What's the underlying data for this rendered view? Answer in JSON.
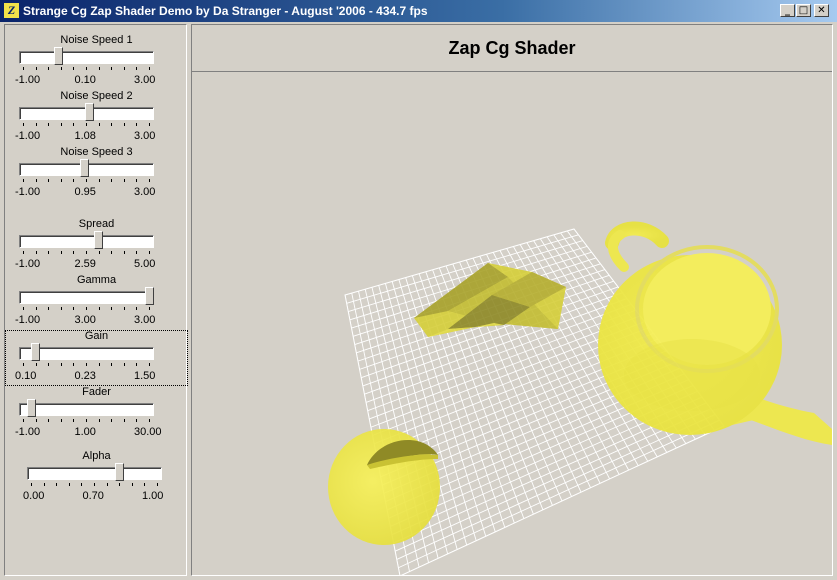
{
  "window": {
    "title": "Strange Cg Zap Shader Demo by Da Stranger  -  August '2006  -  434.7 fps",
    "icon": "app-icon",
    "icon_glyph": "Z",
    "buttons": {
      "minimize": "_",
      "maximize": "□",
      "close": "✕"
    }
  },
  "sliders": [
    {
      "label": "Noise Speed 1",
      "min": "-1.00",
      "value": "0.10",
      "max": "3.00",
      "position": 0.275
    },
    {
      "label": "Noise Speed 2",
      "min": "-1.00",
      "value": "1.08",
      "max": "3.00",
      "position": 0.52
    },
    {
      "label": "Noise Speed 3",
      "min": "-1.00",
      "value": "0.95",
      "max": "3.00",
      "position": 0.4875
    },
    {
      "label": "Spread",
      "min": "-1.00",
      "value": "2.59",
      "max": "5.00",
      "position": 0.598
    },
    {
      "label": "Gamma",
      "min": "-1.00",
      "value": "3.00",
      "max": "3.00",
      "position": 1.0
    },
    {
      "label": "Gain",
      "min": "0.10",
      "value": "0.23",
      "max": "1.50",
      "position": 0.093,
      "focused": true
    },
    {
      "label": "Fader",
      "min": "-1.00",
      "value": "1.00",
      "max": "30.00",
      "position": 0.065
    },
    {
      "label": "Alpha",
      "min": "0.00",
      "value": "0.70",
      "max": "1.00",
      "position": 0.7
    }
  ],
  "viewport": {
    "title": "Zap Cg Shader",
    "object_color": "#efe94a",
    "grid_color": "#ffffff",
    "background_color": "#d4d0c8"
  }
}
